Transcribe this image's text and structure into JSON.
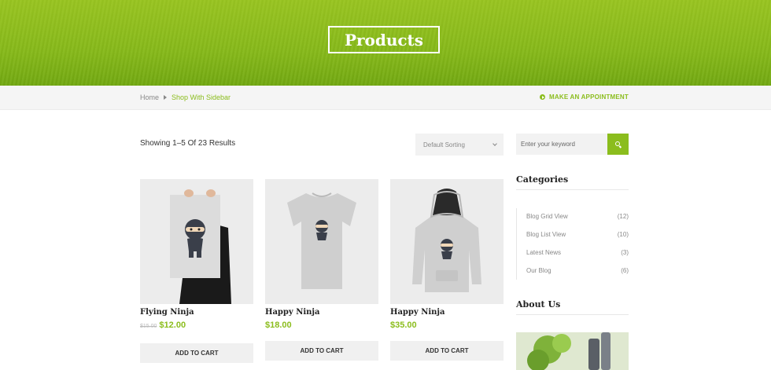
{
  "hero": {
    "title": "Products"
  },
  "breadcrumb": {
    "home": "Home",
    "current": "Shop With Sidebar"
  },
  "appointment": {
    "label": "MAKE AN APPOINTMENT"
  },
  "toolbar": {
    "results": "Showing 1–5 Of 23 Results",
    "sort_selected": "Default Sorting"
  },
  "products": [
    {
      "name": "Flying Ninja",
      "old_price": "$15.00",
      "price": "$12.00",
      "cart_label": "ADD TO CART"
    },
    {
      "name": "Happy Ninja",
      "old_price": "",
      "price": "$18.00",
      "cart_label": "ADD TO CART"
    },
    {
      "name": "Happy Ninja",
      "old_price": "",
      "price": "$35.00",
      "cart_label": "ADD TO CART"
    }
  ],
  "sidebar": {
    "search_placeholder": "Enter your keyword",
    "categories_title": "Categories",
    "categories": [
      {
        "label": "Blog Grid View",
        "count": "(12)"
      },
      {
        "label": "Blog List View",
        "count": "(10)"
      },
      {
        "label": "Latest News",
        "count": "(3)"
      },
      {
        "label": "Our Blog",
        "count": "(6)"
      }
    ],
    "about_title": "About Us"
  },
  "colors": {
    "accent": "#8bbd1d",
    "hero": "#93c61f",
    "button_bg": "#f0f0f0"
  },
  "icons": [
    "chevron-right-icon",
    "play-circle-icon",
    "chevron-down-icon",
    "search-icon"
  ]
}
